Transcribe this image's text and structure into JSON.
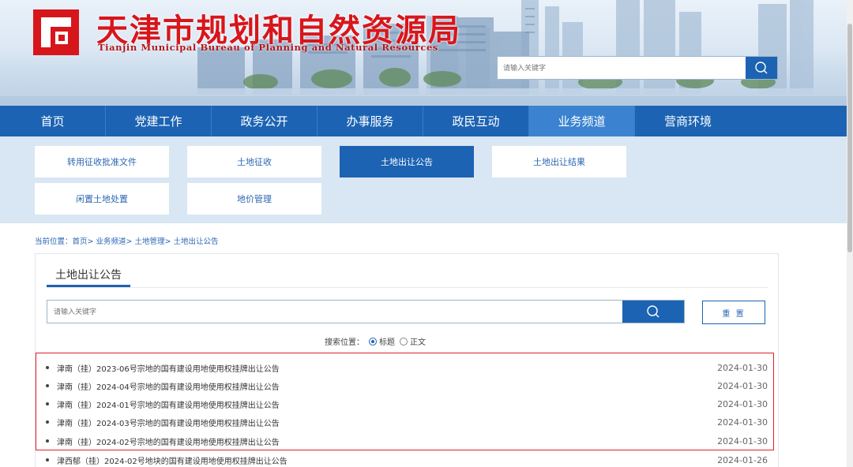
{
  "header": {
    "title": "天津市规划和自然资源局",
    "subtitle": "Tianjin Municipal Bureau of Planning and Natural Resources",
    "search_placeholder": "请输入关键字",
    "colors": {
      "brand_red": "#d7161c",
      "brand_blue": "#1c63b3"
    }
  },
  "nav": {
    "items": [
      {
        "label": "首页"
      },
      {
        "label": "党建工作"
      },
      {
        "label": "政务公开"
      },
      {
        "label": "办事服务"
      },
      {
        "label": "政民互动"
      },
      {
        "label": "业务频道",
        "active": true
      },
      {
        "label": "营商环境"
      }
    ]
  },
  "subnav": {
    "items": [
      {
        "label": "转用征收批准文件"
      },
      {
        "label": "土地征收"
      },
      {
        "label": "土地出让公告",
        "active": true
      },
      {
        "label": "土地出让结果"
      },
      {
        "label": "闲置土地处置"
      },
      {
        "label": "地价管理"
      }
    ]
  },
  "breadcrumb": "当前位置：首页> 业务频道> 土地管理> 土地出让公告",
  "panel": {
    "tab_label": "土地出让公告",
    "search_placeholder": "请输入关键字",
    "reset_label": "重 置",
    "search_scope_label": "搜索位置：",
    "scope_options": [
      {
        "label": "标题",
        "checked": true
      },
      {
        "label": "正文",
        "checked": false
      }
    ]
  },
  "announcements": [
    {
      "title": "津南（挂）2023-06号宗地的国有建设用地使用权挂牌出让公告",
      "date": "2024-01-30",
      "highlighted": true
    },
    {
      "title": "津南（挂）2024-04号宗地的国有建设用地使用权挂牌出让公告",
      "date": "2024-01-30",
      "highlighted": true
    },
    {
      "title": "津南（挂）2024-01号宗地的国有建设用地使用权挂牌出让公告",
      "date": "2024-01-30",
      "highlighted": true
    },
    {
      "title": "津南（挂）2024-03号宗地的国有建设用地使用权挂牌出让公告",
      "date": "2024-01-30",
      "highlighted": true
    },
    {
      "title": "津南（挂）2024-02号宗地的国有建设用地使用权挂牌出让公告",
      "date": "2024-01-30",
      "highlighted": true
    },
    {
      "title": "津西郁（挂）2024-02号地块的国有建设用地使用权挂牌出让公告",
      "date": "2024-01-26",
      "highlighted": false
    }
  ]
}
